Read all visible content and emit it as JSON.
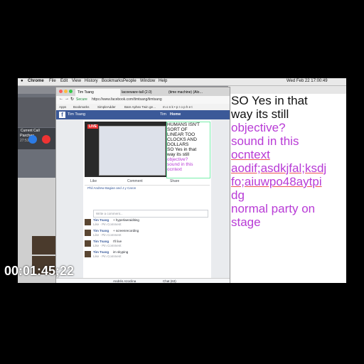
{
  "menubar": {
    "apple": "",
    "items": [
      "Chrome",
      "File",
      "Edit",
      "View",
      "History",
      "Bookmarks",
      "People",
      "Window",
      "Help"
    ],
    "clock": "Wed Feb 22 17:00:49"
  },
  "call": {
    "current_call": "Current Call",
    "name": "Parches",
    "duration": "27:51"
  },
  "browser": {
    "tabs": [
      "Tim Tsang",
      "lacoeware-tall (2.0) ",
      "(time machine) (Alo…"
    ],
    "secure": "Secure",
    "url": "https://www.facebook.com/timtsang/timtsang",
    "bookmarks": [
      "Apps",
      "Bookmarks",
      "SimpleAdder",
      "Bare Aphex Twin ge…",
      "m o n k • p r o p h e t"
    ],
    "fb_name": "Tim Tsang",
    "fb_user": "Tim",
    "fb_home": "Home"
  },
  "post": {
    "live": "LIVE",
    "overlay_black": [
      "HUMANS ISN'T",
      "SORT OF",
      "LINEAR TOO",
      "CLOCKS AND",
      "DOLLARS",
      "SO Yes in that",
      "way its still"
    ],
    "overlay_purple": [
      "objective?",
      "sound in this",
      "ocntext"
    ],
    "actions": [
      "Like",
      "Comment",
      "Share"
    ],
    "reactions": "Phil Andrew Bagian and J.y Caron",
    "write_comment": "Write a comment...",
    "comments": [
      {
        "name": "Tim Tsang",
        "text": "+ hyperlaeraiditing",
        "sub": "Like · Pin Comment"
      },
      {
        "name": "Tim Tsang",
        "text": "+ screenrecording",
        "sub": "Like · Pin Comment"
      },
      {
        "name": "Tim Tsang",
        "text": "I'll live",
        "sub": "Like · Pin Comment"
      },
      {
        "name": "Tim Tsang",
        "text": "im skyping",
        "sub": "Like · Pin Comment"
      }
    ],
    "chat_label": "Chat (63)",
    "chat_person": "Andrés Azoclina"
  },
  "document": {
    "lines": [
      {
        "text": "SO Yes in that",
        "style": "black"
      },
      {
        "text": "way its still",
        "style": "black"
      },
      {
        "text": "objective?",
        "style": "purple"
      },
      {
        "text": "sound in this",
        "style": "purple"
      },
      {
        "text": "ocntext",
        "style": "purple-u"
      },
      {
        "text": "aodif;asdkjfal;ksdj",
        "style": "purple-u"
      },
      {
        "text": "fo;aiuwpo48aytpi",
        "style": "purple-u"
      },
      {
        "text": "dg",
        "style": "purple"
      },
      {
        "text": "normal party on",
        "style": "purple"
      },
      {
        "text": "stage",
        "style": "purple"
      }
    ]
  },
  "timecode": "00:01:45;22"
}
